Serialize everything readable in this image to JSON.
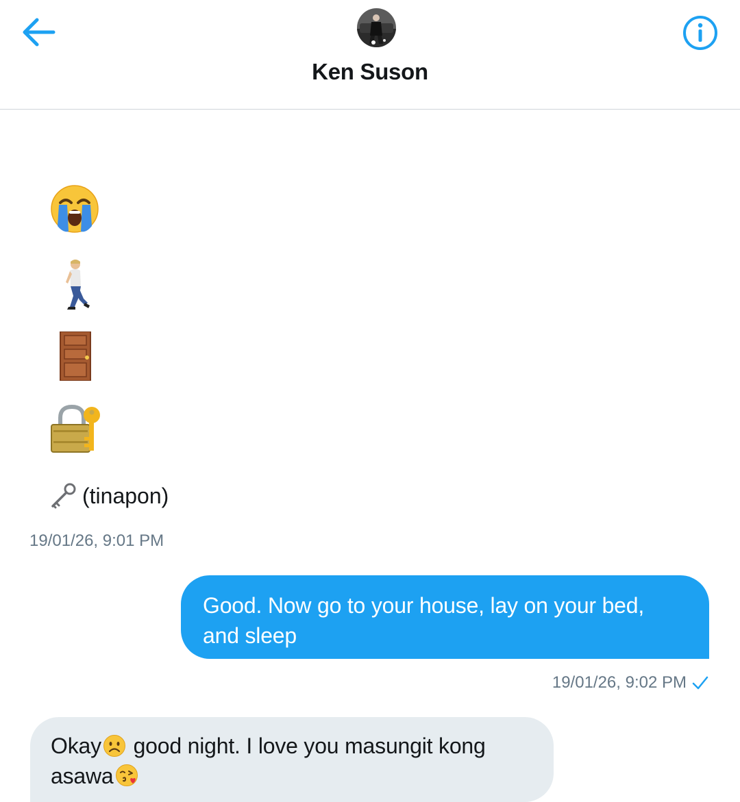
{
  "header": {
    "contact_name": "Ken Suson",
    "back_icon": "arrow-left-icon",
    "info_icon": "info-circle-icon",
    "accent_color": "#1da1f2"
  },
  "messages": [
    {
      "direction": "incoming",
      "emojis": [
        "loudly-crying-face",
        "person-walking",
        "door",
        "locked-with-key"
      ],
      "text": "(tinapon)",
      "text_prefix_icon": "old-key-icon",
      "timestamp": "19/01/26, 9:01 PM"
    },
    {
      "direction": "outgoing",
      "line1": "Good. Now go to your house, lay on your bed,",
      "line2": "and sleep",
      "timestamp": "19/01/26, 9:02 PM",
      "status_icon": "sent-check-icon"
    },
    {
      "direction": "incoming",
      "part1": "Okay",
      "part2": " good night. I love you masungit kong",
      "part3": "asawa",
      "emojis": [
        "frowning-face",
        "face-blowing-kiss"
      ]
    }
  ]
}
